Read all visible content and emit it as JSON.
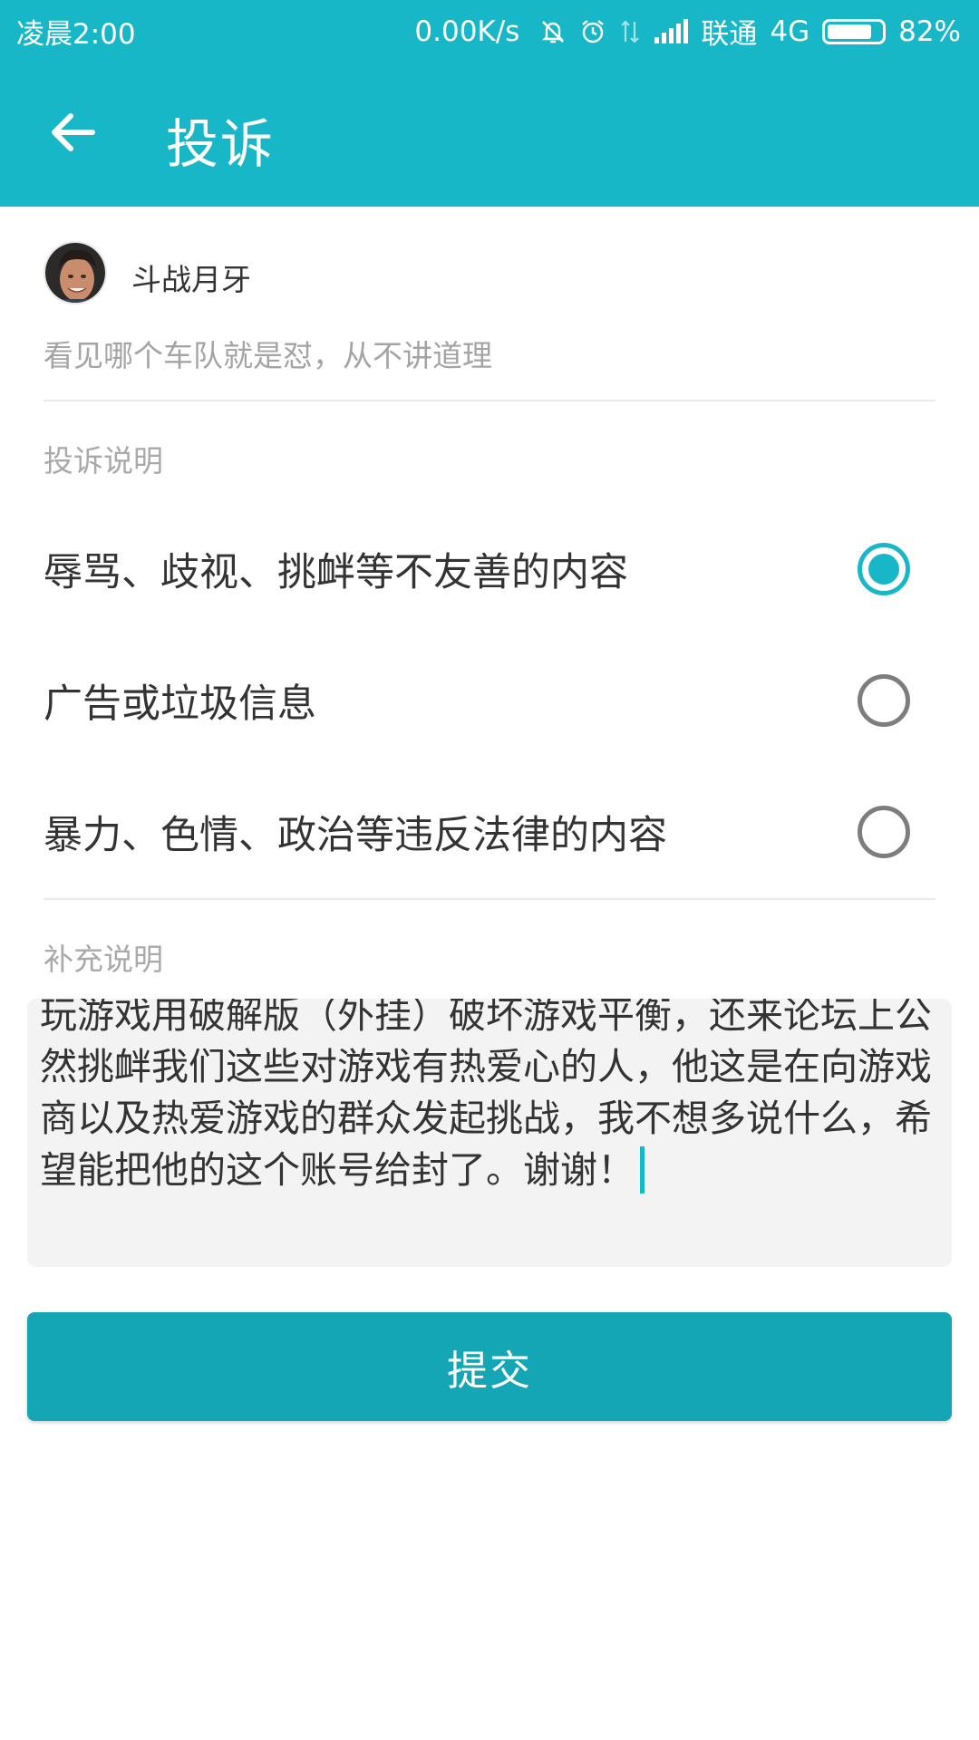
{
  "status_bar": {
    "time": "凌晨2:00",
    "net_speed": "0.00K/s",
    "carrier": "联通",
    "network": "4G",
    "battery": "82%",
    "battery_level": 0.82,
    "icons": [
      "mute-bell-icon",
      "alarm-clock-icon",
      "data-transfer-icon",
      "signal-bars-icon",
      "battery-icon"
    ]
  },
  "app_bar": {
    "title": "投诉",
    "back_icon": "arrow-left-icon"
  },
  "user": {
    "name": "斗战月牙",
    "signature": "看见哪个车队就是怼，从不讲道理"
  },
  "complaint": {
    "section_label": "投诉说明",
    "options": [
      {
        "label": "辱骂、歧视、挑衅等不友善的内容",
        "checked": true
      },
      {
        "label": "广告或垃圾信息",
        "checked": false
      },
      {
        "label": "暴力、色情、政治等违反法律的内容",
        "checked": false
      }
    ]
  },
  "supplement": {
    "section_label": "补充说明",
    "text": "玩游戏用破解版（外挂）破坏游戏平衡，还来论坛上公然挑衅我们这些对游戏有热爱心的人，他这是在向游戏商以及热爱游戏的群众发起挑战，我不想多说什么，希望能把他的这个账号给封了。谢谢！"
  },
  "submit_label": "提交",
  "colors": {
    "accent": "#18b7c8",
    "button": "#14a6b4"
  }
}
